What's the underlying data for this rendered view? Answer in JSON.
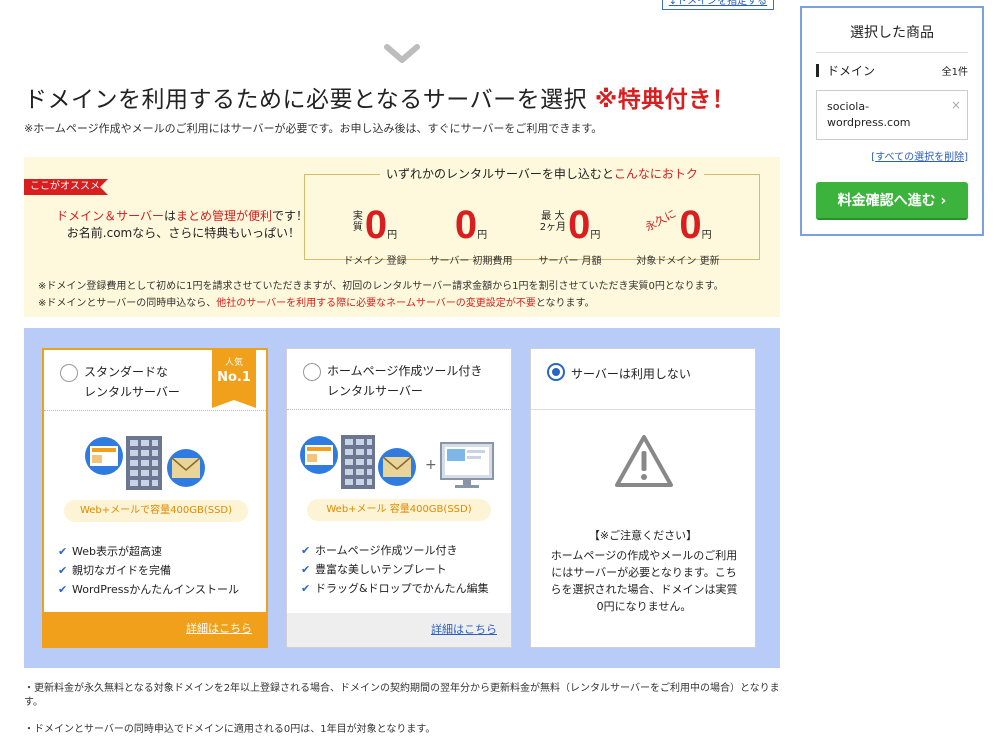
{
  "top_link": "↓ドメインを指定する",
  "heading": {
    "main": "ドメインを利用するために必要となるサーバーを選択",
    "highlight": "※特典付き！",
    "sub": "※ホームページ作成やメールのご利用にはサーバーが必要です。お申し込み後は、すぐにサーバーをご利用できます。"
  },
  "promo": {
    "ribbon": "ここがオススメ",
    "line1_red1": "ドメイン＆サーバー",
    "line1_mid": "は",
    "line1_red2": "まとめ管理が便利",
    "line1_end": "です！",
    "line2": "お名前.comなら、さらに特典もいっぱい！",
    "box_head": "いずれかのレンタルサーバーを申し込むと",
    "box_head_red": "こんなにおトク",
    "items": [
      {
        "pre": "実\n質",
        "num": "0",
        "yen": "円",
        "label": "ドメイン 登録"
      },
      {
        "pre": "",
        "num": "0",
        "yen": "円",
        "label": "サーバー 初期費用"
      },
      {
        "pre": "最 大\n2ヶ月",
        "num": "0",
        "yen": "円",
        "label": "サーバー 月額"
      },
      {
        "pre": "永久に",
        "num": "0",
        "yen": "円",
        "label": "対象ドメイン 更新"
      }
    ],
    "note1": "※ドメイン登録費用として初めに1円を請求させていただきますが、初回のレンタルサーバー請求金額から1円を割引させていただき実質0円となります。",
    "note2_a": "※ドメインとサーバーの同時申込なら、",
    "note2_red": "他社のサーバーを利用する際に必要なネームサーバーの変更設定が不要",
    "note2_b": "となります。"
  },
  "plans": [
    {
      "title": "スタンダードな\nレンタルサーバー",
      "badge_top": "人気",
      "badge_main": "No.1",
      "spec": "Web+メールで容量400GB(SSD)",
      "features": [
        "Web表示が超高速",
        "親切なガイドを完備",
        "WordPressかんたんインストール"
      ],
      "link": "詳細はこちら",
      "selected": false
    },
    {
      "title": "ホームページ作成ツール付き\nレンタルサーバー",
      "spec": "Web+メール 容量400GB(SSD)",
      "features": [
        "ホームページ作成ツール付き",
        "豊富な美しいテンプレート",
        "ドラッグ&ドロップでかんたん編集"
      ],
      "link": "詳細はこちら",
      "selected": false
    },
    {
      "title": "サーバーは利用しない",
      "warn_title": "【※ご注意ください】",
      "warn_body": "ホームページの作成やメールのご利用にはサーバーが必要となります。こちらを選択された場合、ドメインは実質0円になりません。",
      "selected": true
    }
  ],
  "footnotes": {
    "f1": "・更新料金が永久無料となる対象ドメインを2年以上登録される場合、ドメインの契約期間の翌年分から更新料金が無料（レンタルサーバーをご利用中の場合）となります。",
    "f2": "・ドメインとサーバーの同時申込でドメインに適用される0円は、1年目が対象となります。"
  },
  "panel": {
    "title": "選択した商品",
    "domain_label": "ドメイン",
    "count": "全1件",
    "domain_value": "sociola-\nwordpress.com",
    "remove": "×",
    "delete_all": "すべての選択を削除",
    "proceed": "料金確認へ進む ›"
  },
  "colors": {
    "accent_red": "#d81e1e",
    "orange": "#f0a01a",
    "plan_bg": "#b9cbf7",
    "promo_bg": "#fef9dc",
    "green": "#3cb33c",
    "blue": "#2a64c8"
  }
}
